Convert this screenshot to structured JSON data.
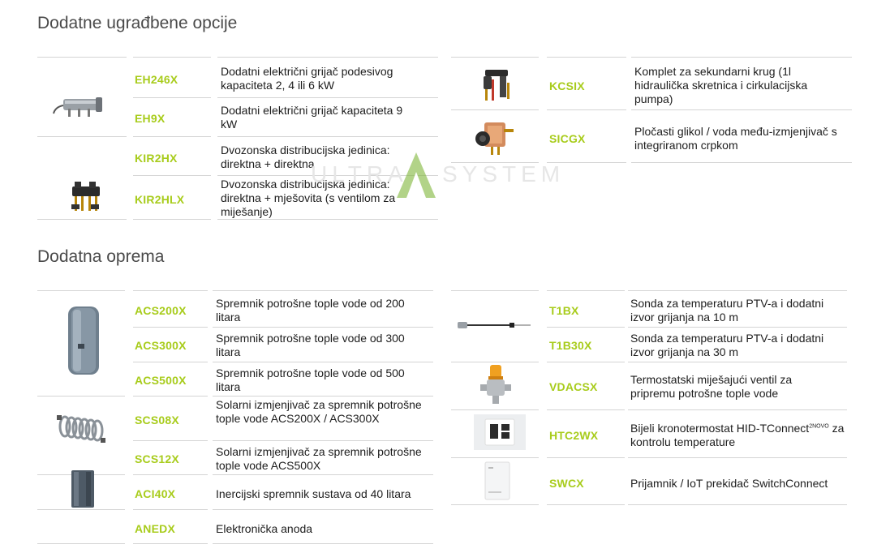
{
  "sections": {
    "built_in_title": "Dodatne ugrađbene opcije",
    "accessories_title": "Dodatna oprema"
  },
  "watermark": {
    "left": "ULTRA",
    "right": "SYSTEM"
  },
  "built_in": {
    "EH246X": {
      "code": "EH246X",
      "desc": "Dodatni električni grijač podesivog kapaciteta 2, 4 ili 6 kW"
    },
    "EH9X": {
      "code": "EH9X",
      "desc": "Dodatni električni grijač kapaciteta 9 kW"
    },
    "KIR2HX": {
      "code": "KIR2HX",
      "desc": "Dvozonska distribucijska jedinica: direktna + direktna"
    },
    "KIR2HLX": {
      "code": "KIR2HLX",
      "desc": "Dvozonska distribucijska jedinica: direktna + mješovita (s ventilom za miješanje)"
    },
    "KCSIX": {
      "code": "KCSIX",
      "desc": "Komplet za sekundarni krug (1l hidraulička skretnica i cirkulacijska pumpa)"
    },
    "SICGX": {
      "code": "SICGX",
      "desc": "Pločasti glikol / voda među-izmjenjivač s integriranom crpkom"
    }
  },
  "accessories": {
    "ACS200X": {
      "code": "ACS200X",
      "desc": "Spremnik potrošne tople vode od 200 litara"
    },
    "ACS300X": {
      "code": "ACS300X",
      "desc": "Spremnik potrošne tople vode od 300 litara"
    },
    "ACS500X": {
      "code": "ACS500X",
      "desc": "Spremnik potrošne tople vode od 500 litara"
    },
    "SCS08X": {
      "code": "SCS08X",
      "desc": "Solarni izmjenjivač za spremnik potrošne tople vode ACS200X / ACS300X"
    },
    "SCS12X": {
      "code": "SCS12X",
      "desc": "Solarni izmjenjivač za spremnik potrošne tople vode ACS500X"
    },
    "ACI40X": {
      "code": "ACI40X",
      "desc": "Inercijski spremnik sustava od 40 litara"
    },
    "ANEDX": {
      "code": "ANEDX",
      "desc": "Elektronička anoda"
    },
    "T1BX": {
      "code": "T1BX",
      "desc": "Sonda za temperaturu PTV-a i dodatni izvor grijanja na 10 m"
    },
    "T1B30X": {
      "code": "T1B30X",
      "desc": "Sonda za temperaturu PTV-a i dodatni izvor grijanja na 30 m"
    },
    "VDACSX": {
      "code": "VDACSX",
      "desc": "Termostatski miješajući ventil za pripremu potrošne tople vode"
    },
    "HTC2WX": {
      "code": "HTC2WX",
      "desc": "Bijeli kronotermostat HID-TConnect",
      "sup": "2NOVO",
      "desc2": " za kontrolu temperature"
    },
    "SWCX": {
      "code": "SWCX",
      "desc": "Prijamnik / IoT prekidač SwitchConnect"
    }
  },
  "colors": {
    "code": "#a8cc1c",
    "line": "#d4d4d4",
    "heading": "#4a4a4a"
  }
}
